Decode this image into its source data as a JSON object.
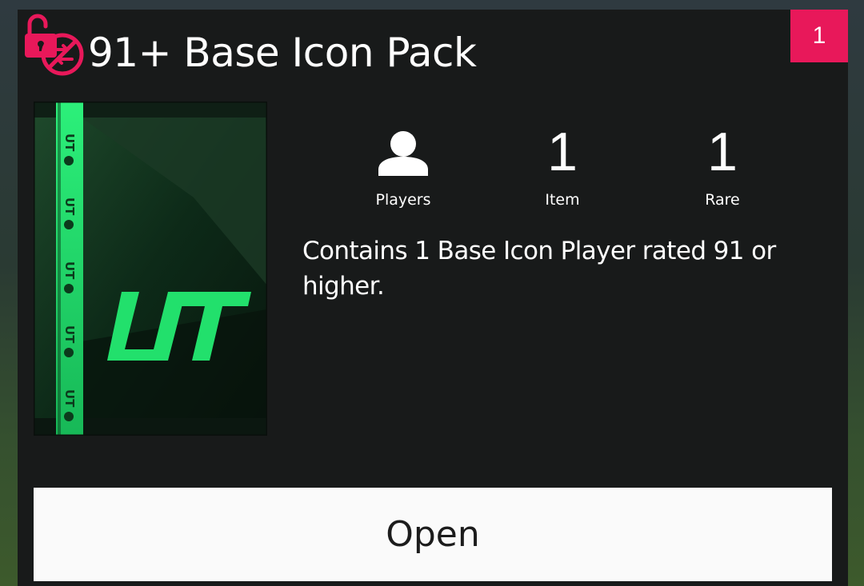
{
  "pack": {
    "title": "91+ Base Icon Pack",
    "count": "1",
    "description": "Contains 1 Base Icon Player rated 91 or higher.",
    "art_brand": "UT"
  },
  "stats": {
    "players_icon": "person-icon",
    "players_label": "Players",
    "item_value": "1",
    "item_label": "Item",
    "rare_value": "1",
    "rare_label": "Rare"
  },
  "actions": {
    "open_label": "Open"
  },
  "icons": {
    "lock": "unlocked-lock-icon",
    "untradeable": "no-trade-icon"
  },
  "colors": {
    "accent": "#e8185a",
    "card_bg": "#181a1a",
    "pack_green": "#1fe06a",
    "button_bg": "#fafafa"
  }
}
